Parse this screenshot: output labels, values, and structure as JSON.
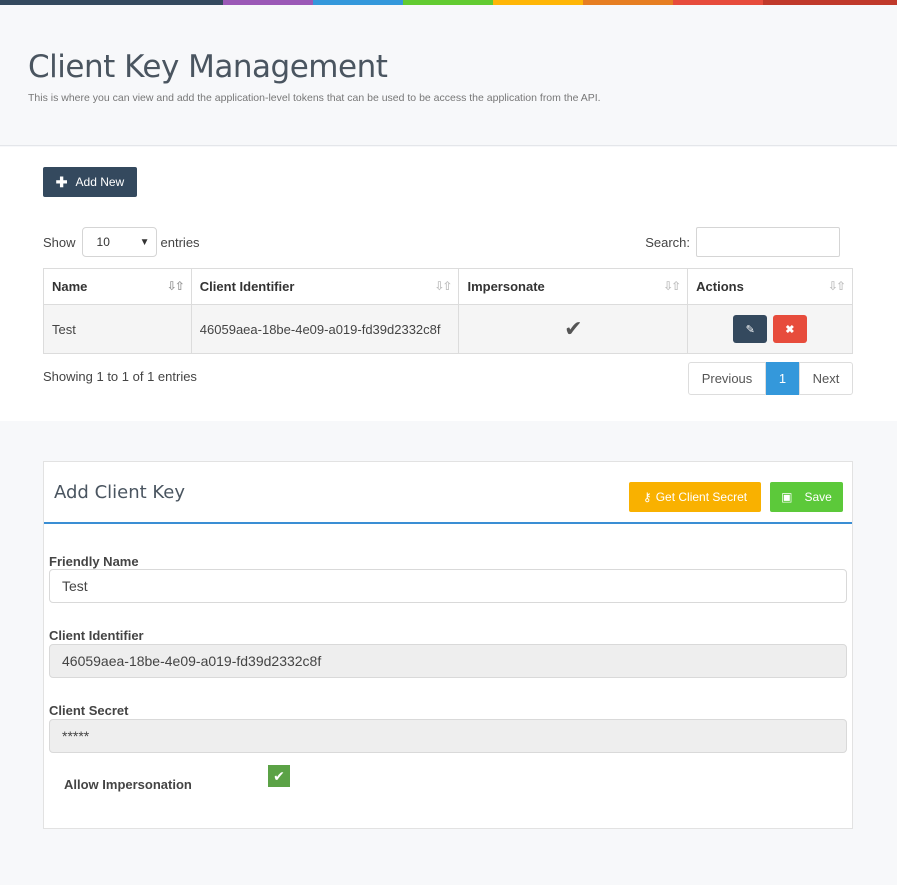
{
  "topbar": {
    "colors": [
      "#34495e",
      "#9b59b6",
      "#3498db",
      "#62cb31",
      "#ffb606",
      "#e67e22",
      "#e74c3c",
      "#c0392b"
    ]
  },
  "header": {
    "title": "Client Key Management",
    "subtitle": "This is where you can view and add the application-level tokens that can be used to be access the application from the API."
  },
  "list": {
    "add_label": "Add New",
    "show_label": "Show",
    "entries_label": "entries",
    "page_size": "10",
    "search_label": "Search:",
    "search_value": "",
    "columns": [
      "Name",
      "Client Identifier",
      "Impersonate",
      "Actions"
    ],
    "rows": [
      {
        "name": "Test",
        "client_identifier": "46059aea-18be-4e09-a019-fd39d2332c8f",
        "impersonate": true
      }
    ],
    "info": "Showing 1 to 1 of 1 entries",
    "pager": {
      "previous": "Previous",
      "current": "1",
      "next": "Next"
    }
  },
  "form": {
    "title": "Add Client Key",
    "get_secret_label": "Get Client Secret",
    "save_label": "Save",
    "friendly_name_label": "Friendly Name",
    "friendly_name_value": "Test",
    "client_identifier_label": "Client Identifier",
    "client_identifier_value": "46059aea-18be-4e09-a019-fd39d2332c8f",
    "client_secret_label": "Client Secret",
    "client_secret_value": "*****",
    "allow_impersonation_label": "Allow Impersonation",
    "allow_impersonation": true
  },
  "icons": {
    "add": "plus-icon",
    "sort": "sort-arrows-icon",
    "check": "checkmark-icon",
    "edit": "edit-icon",
    "delete": "close-icon",
    "key": "key-icon",
    "save": "floppy-disk-icon",
    "select": "chevron-down-icon"
  }
}
